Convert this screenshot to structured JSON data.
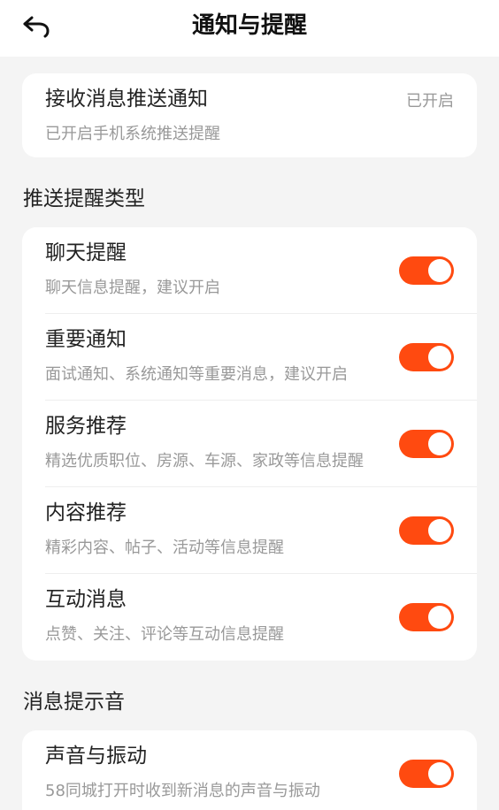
{
  "header": {
    "title": "通知与提醒",
    "back_icon": "undo-arrow-icon"
  },
  "push": {
    "title": "接收消息推送通知",
    "subtitle": "已开启手机系统推送提醒",
    "status": "已开启"
  },
  "section_types": {
    "title": "推送提醒类型"
  },
  "types": [
    {
      "title": "聊天提醒",
      "subtitle": "聊天信息提醒，建议开启",
      "enabled": true
    },
    {
      "title": "重要通知",
      "subtitle": "面试通知、系统通知等重要消息，建议开启",
      "enabled": true
    },
    {
      "title": "服务推荐",
      "subtitle": "精选优质职位、房源、车源、家政等信息提醒",
      "enabled": true
    },
    {
      "title": "内容推荐",
      "subtitle": "精彩内容、帖子、活动等信息提醒",
      "enabled": true
    },
    {
      "title": "互动消息",
      "subtitle": "点赞、关注、评论等互动信息提醒",
      "enabled": true
    }
  ],
  "section_sound": {
    "title": "消息提示音"
  },
  "sound": {
    "title": "声音与振动",
    "subtitle": "58同城打开时收到新消息的声音与振动",
    "enabled": true
  },
  "colors": {
    "accent": "#ff4a10",
    "background": "#f4f4f4",
    "card": "#ffffff",
    "subtext": "#999999"
  }
}
